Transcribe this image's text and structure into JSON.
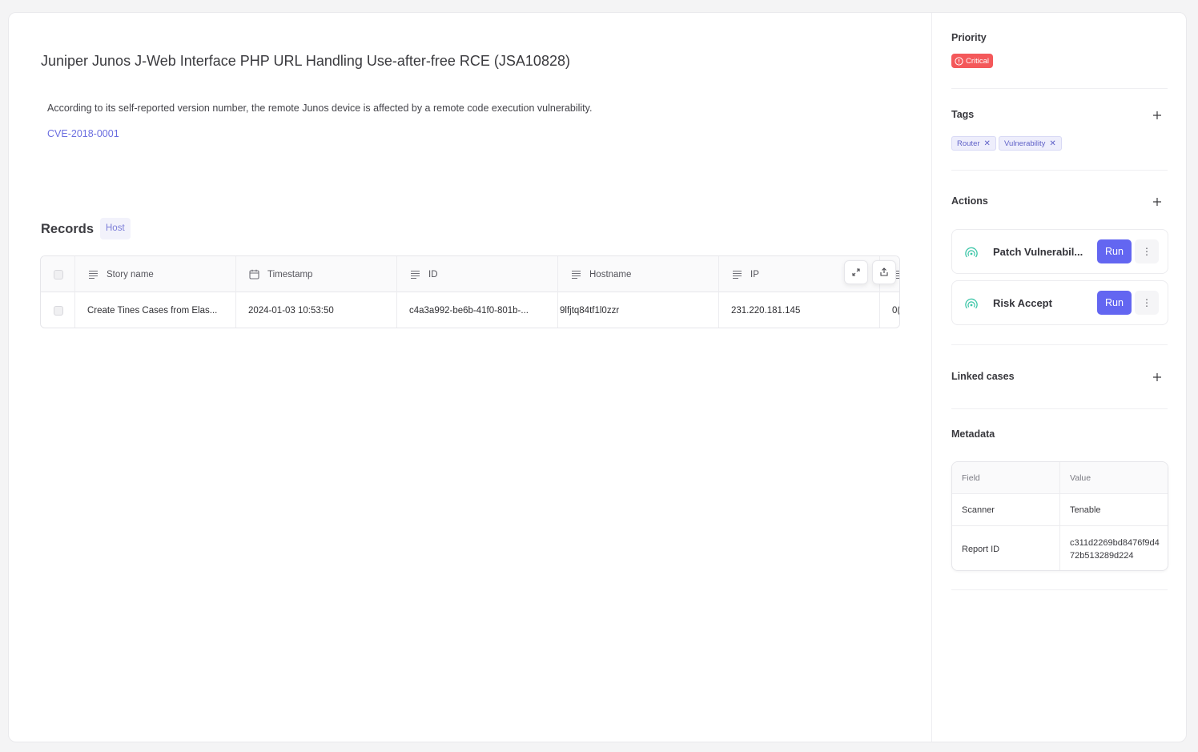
{
  "main": {
    "title": "Juniper Junos J-Web Interface PHP URL Handling Use-after-free RCE (JSA10828)",
    "description": "According to its self-reported version number, the remote Junos device is affected by a remote code execution vulnerability.",
    "cve": "CVE-2018-0001"
  },
  "records": {
    "title": "Records",
    "badge": "Host",
    "columns": [
      "Story name",
      "Timestamp",
      "ID",
      "Hostname",
      "IP"
    ],
    "rows": [
      {
        "story_name": "Create Tines Cases from Elas...",
        "timestamp": "2024-01-03 10:53:50",
        "id": "c4a3a992-be6b-41f0-801b-...",
        "hostname": "9lfjtq84tf1l0zzr",
        "ip": "231.220.181.145",
        "extra": "0("
      }
    ]
  },
  "sidebar": {
    "priority": {
      "label": "Priority",
      "value": "Critical",
      "color": "#f4585a"
    },
    "tags": {
      "label": "Tags",
      "items": [
        "Router",
        "Vulnerability"
      ]
    },
    "actions": {
      "label": "Actions",
      "items": [
        {
          "name": "Patch Vulnerabil...",
          "button": "Run"
        },
        {
          "name": "Risk Accept",
          "button": "Run"
        }
      ]
    },
    "linked_cases": {
      "label": "Linked cases"
    },
    "metadata": {
      "label": "Metadata",
      "headers": [
        "Field",
        "Value"
      ],
      "rows": [
        {
          "field": "Scanner",
          "value": "Tenable"
        },
        {
          "field": "Report ID",
          "value": "c311d2269bd8476f9d472b513289d224"
        }
      ]
    }
  },
  "colors": {
    "accent": "#6366f1",
    "critical": "#f4585a",
    "link": "#6b6ee0",
    "action_icon": "#3ec6a8"
  }
}
